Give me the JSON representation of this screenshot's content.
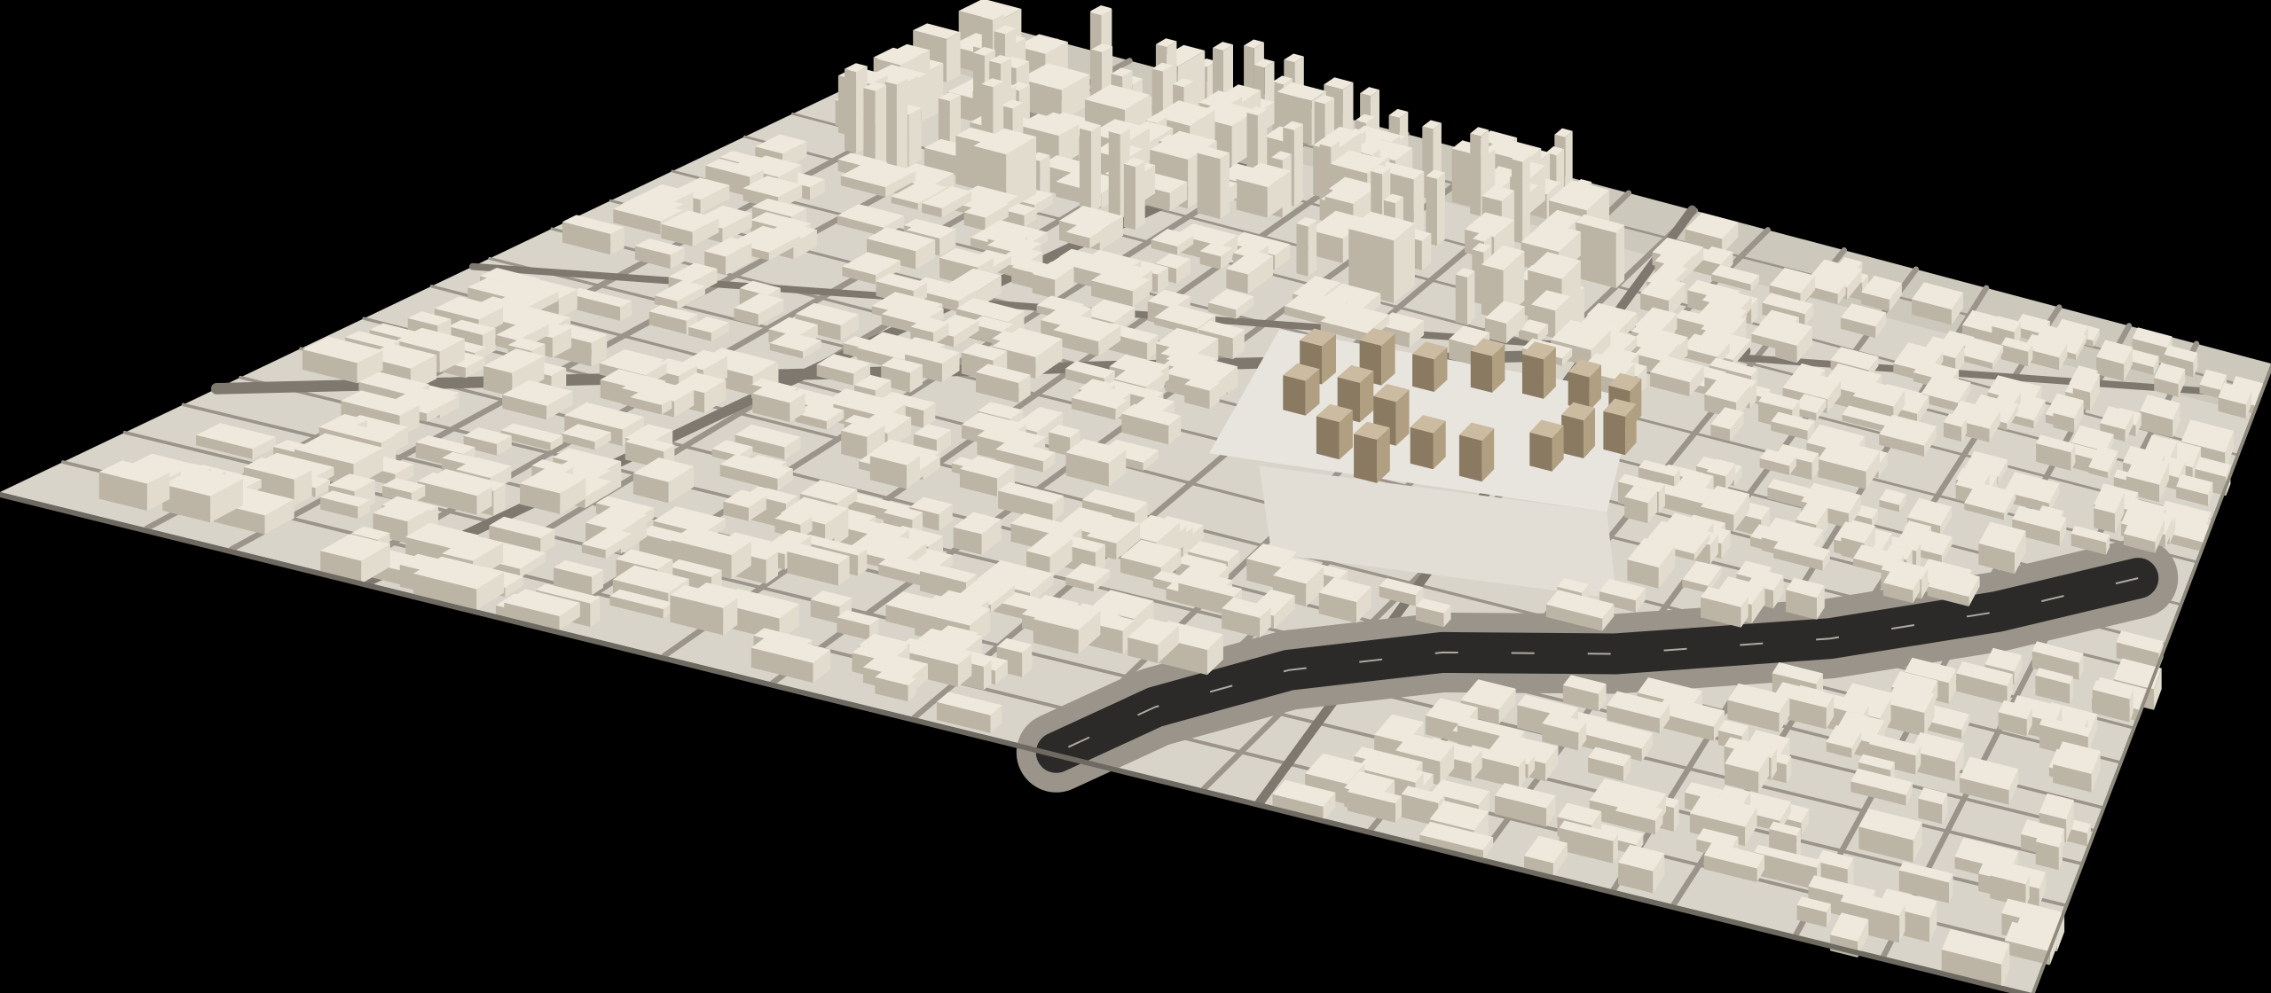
{
  "scene": {
    "subject": "city-model",
    "background_color": "#000000",
    "colors": {
      "ground": "#d9d4ca",
      "ground_shadow": "#a9a395",
      "road": "#9a948a",
      "road_edge": "#7e786f",
      "highway": "#2b2a28",
      "highway_marking": "#cfcac0",
      "building_top": "#efe9dd",
      "building_side_light": "#e2dccf",
      "building_side_dark": "#bcb5a6",
      "highlight_tower_top": "#cbbba0",
      "highlight_tower_light": "#b19f82",
      "highlight_tower_dark": "#8a7a62",
      "plaza": "#e8e5df"
    }
  }
}
